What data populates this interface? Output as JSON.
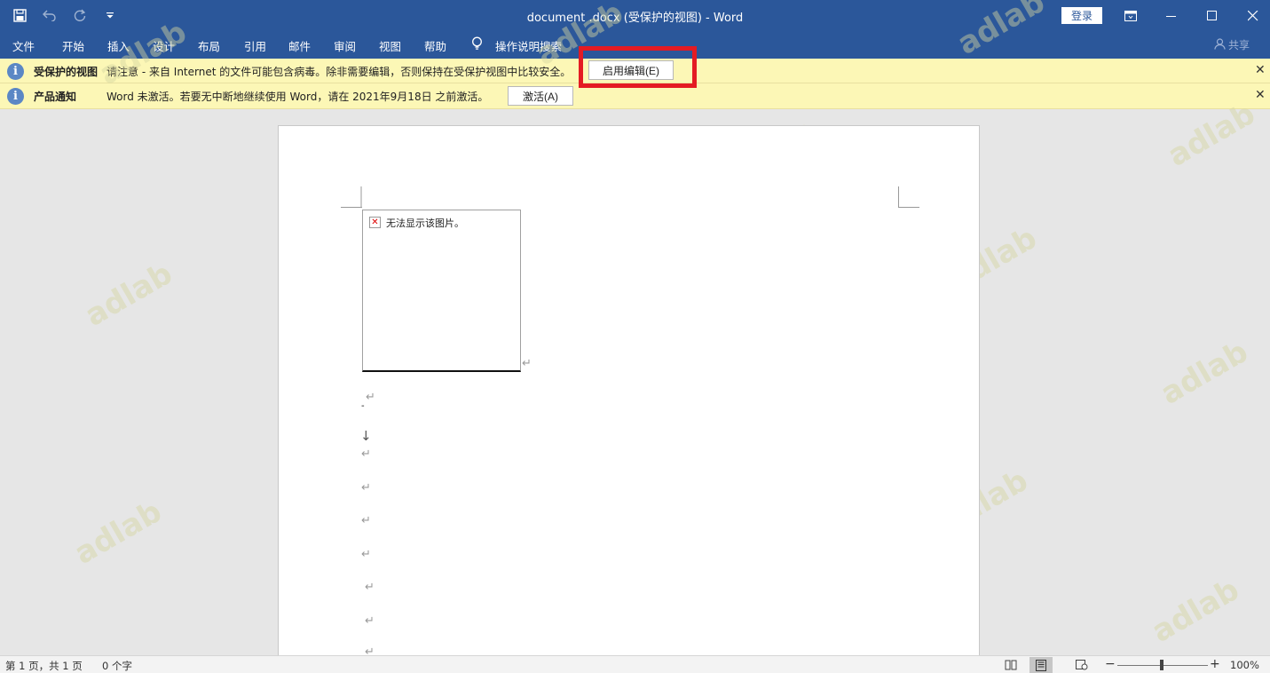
{
  "window": {
    "title": "document .docx (受保护的视图)  -  Word",
    "login_label": "登录"
  },
  "menu": {
    "items": [
      "文件",
      "开始",
      "插入",
      "设计",
      "布局",
      "引用",
      "邮件",
      "审阅",
      "视图",
      "帮助"
    ],
    "tell_me": "操作说明搜索",
    "share": "共享"
  },
  "protected_bar": {
    "title": "受保护的视图",
    "text": "请注意 - 来自 Internet 的文件可能包含病毒。除非需要编辑，否则保持在受保护视图中比较安全。",
    "button": "启用编辑(E)"
  },
  "product_bar": {
    "title": "产品通知",
    "text": "Word 未激活。若要无中断地继续使用 Word，请在 2021年9月18日 之前激活。",
    "button": "激活(A)"
  },
  "document": {
    "broken_image_text": "无法显示该图片。"
  },
  "status": {
    "page": "第 1 页，共 1 页",
    "words": "0 个字",
    "zoom": "100%",
    "zoom_level_percent": 100
  },
  "watermark": "adlab",
  "colors": {
    "ribbon": "#2b579a",
    "message_bar": "#fcf7b6",
    "highlight": "#e41b23"
  }
}
